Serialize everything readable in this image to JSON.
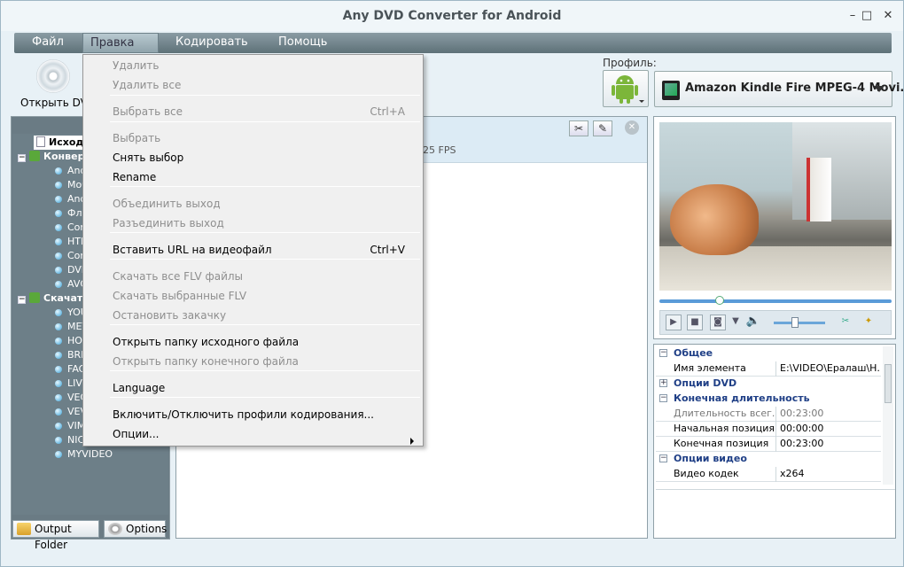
{
  "window": {
    "title": "Any DVD Converter for Android"
  },
  "titlebar_buttons": {
    "minimize": "–",
    "maximize": "□",
    "close": "✕"
  },
  "menubar": [
    "Файл",
    "Правка",
    "Кодировать",
    "Помощь"
  ],
  "toolbar": {
    "open_dvd": "Открыть DVD"
  },
  "tree": {
    "source": "Исходн...",
    "convert": "Конвер...",
    "convert_items": [
      "And",
      "Моб",
      "And",
      "Флe",
      "Com",
      "HTM",
      "Com",
      "DVD",
      "AVC"
    ],
    "download": "Скачат...",
    "download_items": [
      "YOU",
      "MET",
      "HOV",
      "BRE",
      "FAC",
      "LIVE",
      "VEC",
      "VEV",
      "VIM",
      "NIC",
      "MYVIDEO"
    ]
  },
  "bottom_buttons": {
    "output_folder": "Output Folder",
    "options": "Options"
  },
  "center": {
    "fps": "25 FPS"
  },
  "profile": {
    "label": "Профиль:",
    "selected": "Amazon Kindle Fire MPEG-4 Movi..."
  },
  "props": {
    "general": "Общее",
    "item_name_k": "Имя элемента",
    "item_name_v": "E:\\VIDEO\\Ералаш\\Н...",
    "dvd_opts": "Опции DVD",
    "final_dur": "Конечная длительность",
    "dur_k": "Длительность всег...",
    "dur_v": "00:23:00",
    "start_k": "Начальная позиция",
    "start_v": "00:00:00",
    "end_k": "Конечная позиция",
    "end_v": "00:23:00",
    "video_opts": "Опции видео",
    "codec_k": "Видео кодек",
    "codec_v": "x264"
  },
  "dropdown": {
    "items": [
      {
        "label": "Удалить",
        "disabled": true
      },
      {
        "label": "Удалить все",
        "disabled": true
      },
      {
        "label": "Выбрать все",
        "disabled": true,
        "shortcut": "Ctrl+A"
      },
      {
        "label": "Выбрать",
        "disabled": true
      },
      {
        "label": "Снять выбор",
        "disabled": false
      },
      {
        "label": "Rename",
        "disabled": false
      },
      {
        "label": "Объединить выход",
        "disabled": true
      },
      {
        "label": "Разъединить выход",
        "disabled": true
      },
      {
        "label": "Вставить URL на видеофайл",
        "disabled": false,
        "shortcut": "Ctrl+V"
      },
      {
        "label": "Скачать все FLV файлы",
        "disabled": true
      },
      {
        "label": "Скачать выбранные FLV",
        "disabled": true
      },
      {
        "label": "Остановить закачку",
        "disabled": true
      },
      {
        "label": "Открыть папку исходного файла",
        "disabled": false
      },
      {
        "label": "Открыть папку конечного файла",
        "disabled": true
      },
      {
        "label": "Language",
        "disabled": false
      },
      {
        "label": "Включить/Отключить профили кодирования...",
        "disabled": false
      },
      {
        "label": "Опции...",
        "disabled": false
      }
    ]
  },
  "seek_position": 0.26,
  "volume_level": 0.42
}
